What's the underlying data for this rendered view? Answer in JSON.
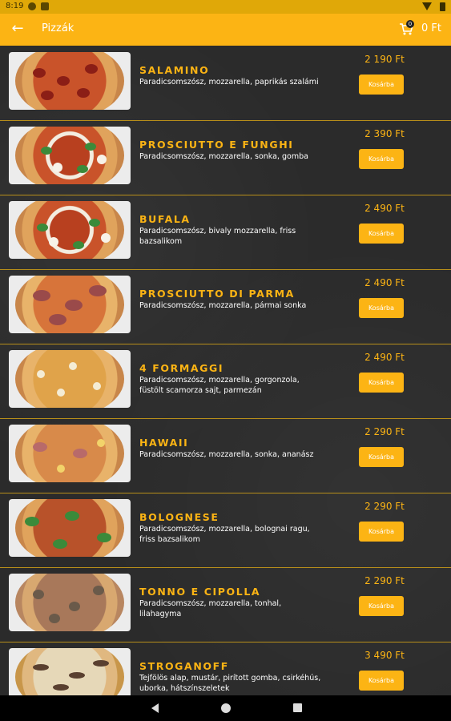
{
  "status_bar": {
    "time": "8:19",
    "icons": [
      "notification-icon",
      "sim-icon",
      "wifi-icon",
      "battery-icon"
    ]
  },
  "app_bar": {
    "title": "Pizzák",
    "cart_count": "0",
    "cart_total": "0 Ft",
    "back_icon": "arrow-left-icon",
    "cart_icon": "cart-icon"
  },
  "colors": {
    "accent": "#fcb414",
    "background": "#2b2b2b",
    "divider": "#b88f1a"
  },
  "products": [
    {
      "name": "SALAMINO",
      "desc": "Paradicsomszósz, mozzarella, paprikás szalámi",
      "price": "2 190 Ft",
      "button": "Kosárba"
    },
    {
      "name": "PROSCIUTTO E FUNGHI",
      "desc": "Paradicsomszósz, mozzarella, sonka, gomba",
      "price": "2 390 Ft",
      "button": "Kosárba"
    },
    {
      "name": "BUFALA",
      "desc": "Paradicsomszósz, bivaly mozzarella, friss bazsalikom",
      "price": "2 490 Ft",
      "button": "Kosárba"
    },
    {
      "name": "PROSCIUTTO DI PARMA",
      "desc": "Paradicsomszósz, mozzarella, pármai sonka",
      "price": "2 490 Ft",
      "button": "Kosárba"
    },
    {
      "name": "4 FORMAGGI",
      "desc": "Paradicsomszósz, mozzarella, gorgonzola, füstölt scamorza sajt, parmezán",
      "price": "2 490 Ft",
      "button": "Kosárba"
    },
    {
      "name": "HAWAII",
      "desc": "Paradicsomszósz, mozzarella, sonka, ananász",
      "price": "2 290 Ft",
      "button": "Kosárba"
    },
    {
      "name": "BOLOGNESE",
      "desc": "Paradicsomszósz, mozzarella, bolognai ragu, friss bazsalikom",
      "price": "2 290 Ft",
      "button": "Kosárba"
    },
    {
      "name": "TONNO E CIPOLLA",
      "desc": "Paradicsomszósz, mozzarella, tonhal, lilahagyma",
      "price": "2 290 Ft",
      "button": "Kosárba"
    },
    {
      "name": "STROGANOFF",
      "desc": "Tejfölös alap, mustár, pirított gomba, csirkéhús, uborka, hátszínszeletek",
      "price": "3 490 Ft",
      "button": "Kosárba"
    }
  ],
  "nav_bar": {
    "icons": [
      "nav-back-icon",
      "nav-home-icon",
      "nav-recent-icon"
    ]
  }
}
